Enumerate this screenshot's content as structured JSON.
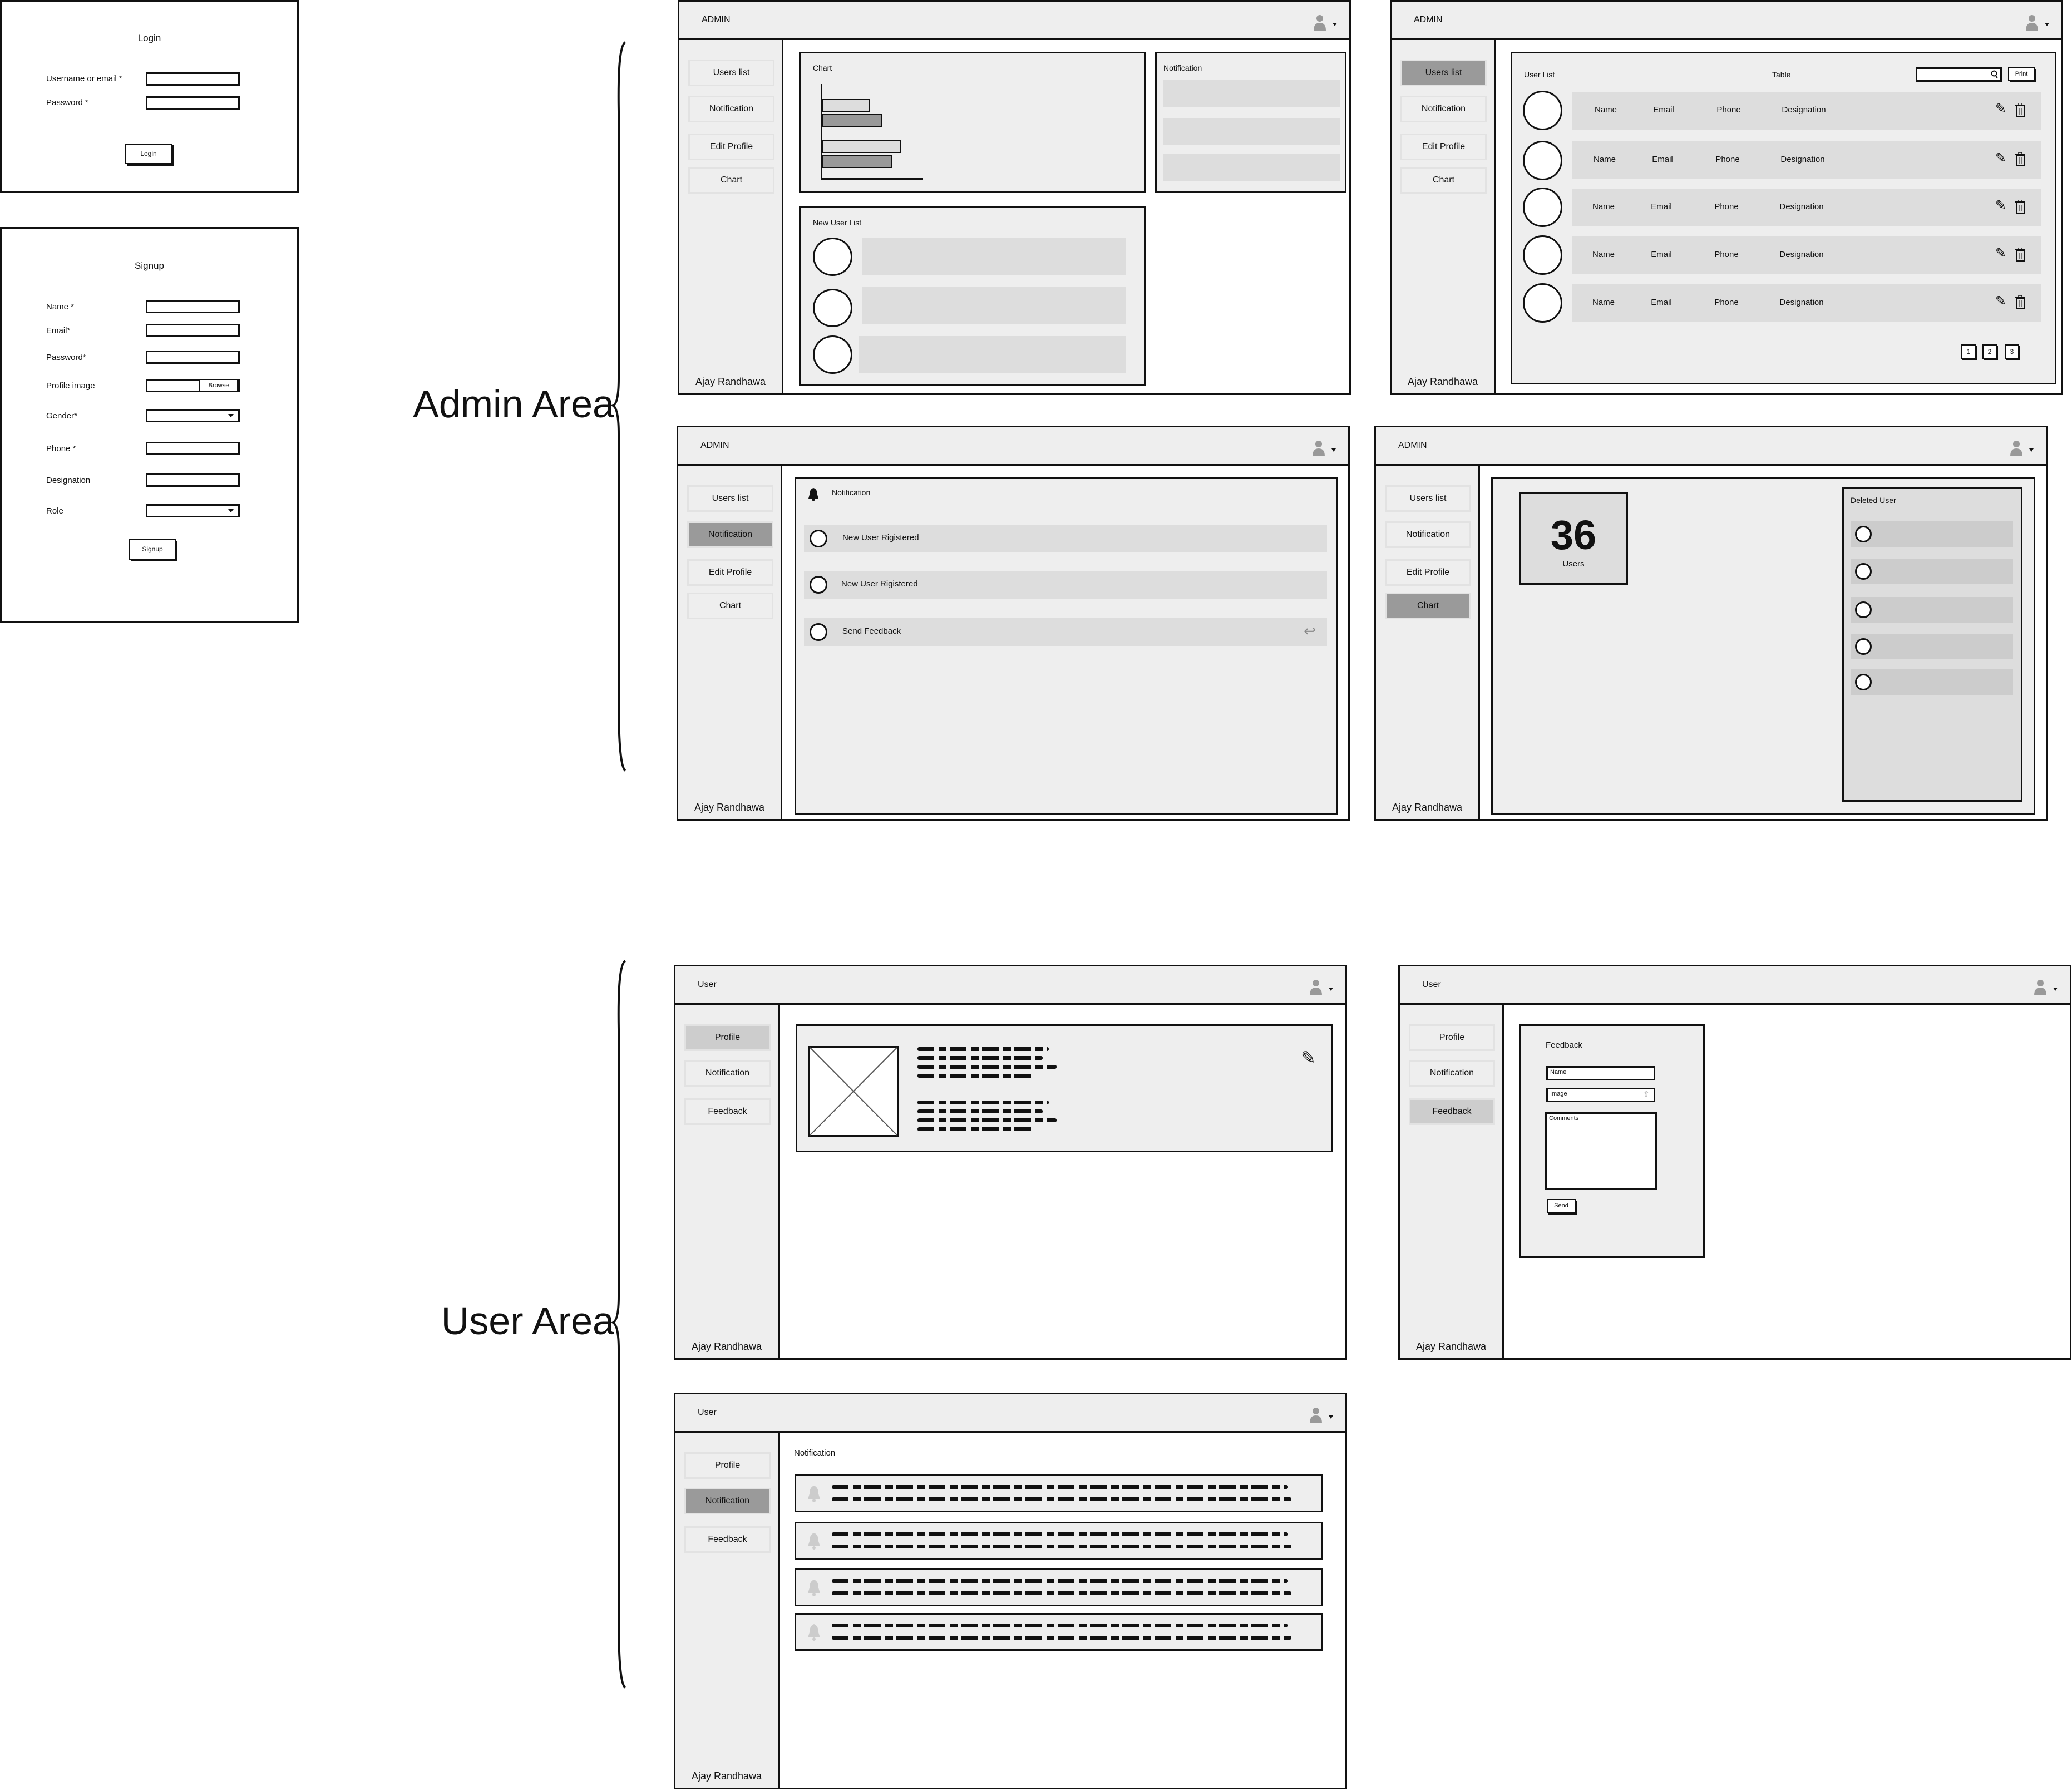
{
  "login": {
    "title": "Login",
    "username_label": "Username or email *",
    "password_label": "Password *",
    "button": "Login"
  },
  "signup": {
    "title": "Signup",
    "fields": [
      "Name *",
      "Email*",
      "Password*",
      "Profile image",
      "Gender*",
      "Phone *",
      "Designation",
      "Role"
    ],
    "browse": "Browse",
    "button": "Signup"
  },
  "sections": {
    "admin": "Admin Area",
    "user": "User Area"
  },
  "admin": {
    "header": "ADMIN",
    "nav": [
      "Users list",
      "Notification",
      "Edit Profile",
      "Chart"
    ],
    "user_name": "Ajay Randhawa",
    "dashboard": {
      "chart_title": "Chart",
      "chart_bars": [
        0.47,
        0.59,
        0.77,
        0.69
      ],
      "notification_title": "Notification",
      "new_users_title": "New User List"
    },
    "users_list": {
      "title": "User List",
      "center_label": "Table",
      "search_value": "",
      "print": "Print",
      "rows": [
        {
          "name": "Name",
          "email": "Email",
          "phone": "Phone",
          "designation": "Designation"
        },
        {
          "name": "Name",
          "email": "Email",
          "phone": "Phone",
          "designation": "Designation"
        },
        {
          "name": "Name",
          "email": "Email",
          "phone": "Phone",
          "designation": "Designation"
        },
        {
          "name": "Name",
          "email": "Email",
          "phone": "Phone",
          "designation": "Designation"
        },
        {
          "name": "Name",
          "email": "Email",
          "phone": "Phone",
          "designation": "Designation"
        }
      ],
      "pages": [
        "1",
        "2",
        "3"
      ]
    },
    "notifications": {
      "title": "Notification",
      "items": [
        "New User Rigistered",
        "New User Rigistered",
        "Send Feedback"
      ]
    },
    "stats": {
      "count": "36",
      "count_label": "Users",
      "deleted_title": "Deleted User"
    }
  },
  "user": {
    "header": "User",
    "nav": [
      "Profile",
      "Notification",
      "Feedback"
    ],
    "user_name": "Ajay Randhawa",
    "feedback": {
      "title": "Feedback",
      "name_placeholder": "Name",
      "image_placeholder": "Image",
      "comments_placeholder": "Comments",
      "send": "Send"
    },
    "notifications": {
      "title": "Notification"
    }
  },
  "colors": {
    "panel": "#eeeeee",
    "row": "#dddddd",
    "active_nav": "#9a9a9a",
    "light_active_nav": "#cdcdcd",
    "stroke": "#111111"
  }
}
